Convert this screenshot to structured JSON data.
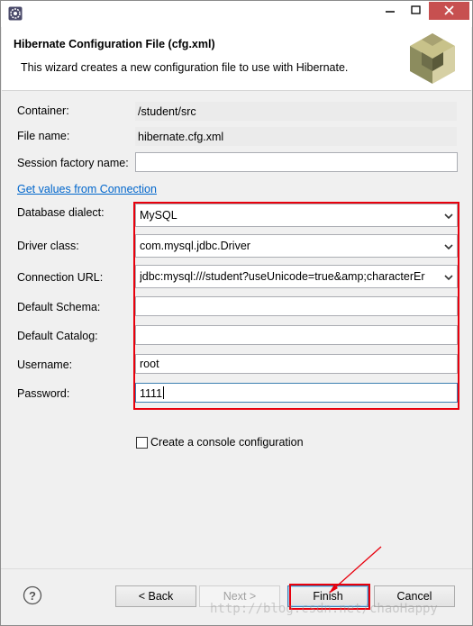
{
  "window": {
    "close_color": "#c75050"
  },
  "header": {
    "title": "Hibernate Configuration File (cfg.xml)",
    "description": "This wizard creates a new configuration file to use with Hibernate."
  },
  "form": {
    "container_label": "Container:",
    "container_value": "/student/src",
    "filename_label": "File name:",
    "filename_value": "hibernate.cfg.xml",
    "session_factory_label": "Session factory name:",
    "session_factory_value": "",
    "get_values_link": "Get values from Connection",
    "dialect_label": "Database dialect:",
    "dialect_value": "MySQL",
    "driver_label": "Driver class:",
    "driver_value": "com.mysql.jdbc.Driver",
    "url_label": "Connection URL:",
    "url_value": "jdbc:mysql:///student?useUnicode=true&amp;characterEr",
    "schema_label": "Default Schema:",
    "schema_value": "",
    "catalog_label": "Default Catalog:",
    "catalog_value": "",
    "username_label": "Username:",
    "username_value": "root",
    "password_label": "Password:",
    "password_value": "1111",
    "console_config_label": "Create a console configuration"
  },
  "footer": {
    "help_icon": "question-icon",
    "back_label": "< Back",
    "next_label": "Next >",
    "finish_label": "Finish",
    "cancel_label": "Cancel"
  },
  "watermark": "http://blog.csdn.net/chaoHappy",
  "colors": {
    "highlight": "#e8000d",
    "link": "#0066cc"
  }
}
